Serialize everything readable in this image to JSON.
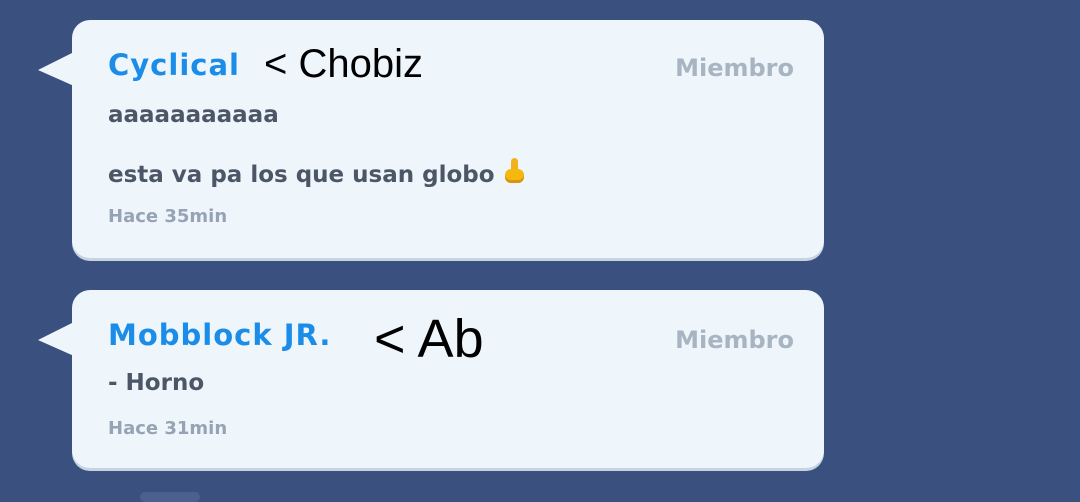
{
  "colors": {
    "background": "#3a5180",
    "bubble": "#eef6fc",
    "username": "#1b8de8",
    "role": "#a9b4c2",
    "message": "#4c5666",
    "time": "#96a3b4",
    "annotation": "#000000"
  },
  "messages": [
    {
      "username": "Cyclical",
      "annotation": "< Chobiz",
      "role": "Miembro",
      "lines": [
        "aaaaaaaaaaa",
        "esta va pa los que usan globo"
      ],
      "emoji": "middle-finger-emoji",
      "time": "Hace 35min"
    },
    {
      "username": "Mobblock JR.",
      "annotation": "< Ab",
      "role": "Miembro",
      "lines": [
        "- Horno"
      ],
      "time": "Hace 31min"
    }
  ]
}
